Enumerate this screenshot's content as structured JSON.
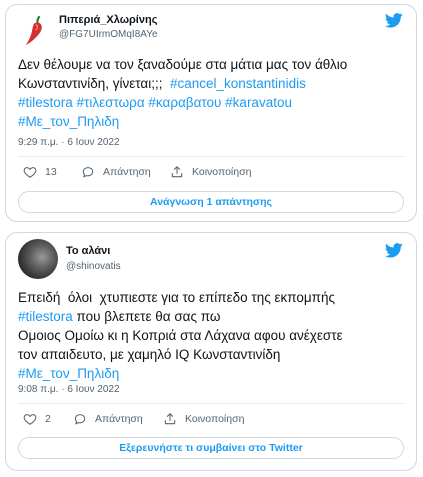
{
  "colors": {
    "link": "#1d9bf0",
    "secondary_text": "#536471",
    "border": "#cfd9de"
  },
  "tweets": [
    {
      "author": {
        "name": "Πιπεριά_Χλωρίνης",
        "handle": "@FG7UIrmOMqI8AYe",
        "avatar": "chili-pepper-avatar"
      },
      "text_lines": [
        [
          "Δεν θέλουμε να τον ξαναδούμε στα μάτια μας τον άθλιο"
        ],
        [
          "Κωνσταντινίδη, γίνεται;;;  ",
          "#cancel_konstantinidis"
        ],
        [
          "#tilestora",
          " ",
          "#τιλεστωρα",
          " ",
          "#καραβατου",
          " ",
          "#karavatou"
        ],
        [
          "#Με_τον_Πηλιδη"
        ]
      ],
      "timestamp": "9:29 π.μ. · 6 Ιουν 2022",
      "likes": "13",
      "reply_label": "Απάντηση",
      "share_label": "Κοινοποίηση",
      "button_label": "Ανάγνωση 1 απάντησης"
    },
    {
      "author": {
        "name": "Το αλάνι",
        "handle": "@shinovatis",
        "avatar": "profile-photo-avatar"
      },
      "text_lines": [
        [
          "Επειδή  όλοι  χτυπιεστε για το επίπεδο της εκπομπής"
        ],
        [
          "#tilestora",
          " που βλεπετε θα σας πω"
        ],
        [
          "Ομοιος Ομοίω κι η Κοπριά στα Λάχανα αφου ανέχεστε"
        ],
        [
          "τον απαιδευτο, με χαμηλό IQ Κωνσταντινίδη"
        ],
        [
          "#Με_τον_Πηλιδη"
        ]
      ],
      "timestamp": "9:08 π.μ. · 6 Ιουν 2022",
      "likes": "2",
      "reply_label": "Απάντηση",
      "share_label": "Κοινοποίηση",
      "button_label": "Εξερευνήστε τι συμβαίνει στο Twitter"
    }
  ]
}
